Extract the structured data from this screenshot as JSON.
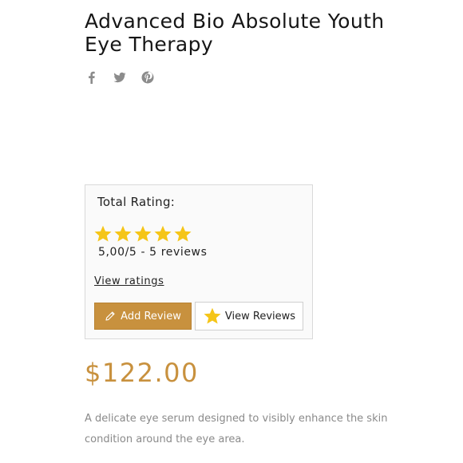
{
  "product": {
    "title": "Advanced Bio Absolute Youth Eye Therapy",
    "price": "$122.00",
    "description": "A delicate eye serum designed to visibly enhance the skin condition around the eye area."
  },
  "share": {
    "icons": [
      "facebook-icon",
      "twitter-icon",
      "pinterest-icon"
    ]
  },
  "rating": {
    "label": "Total Rating:",
    "stars": 5,
    "max_stars": 5,
    "summary": "5,00/5 - 5 reviews",
    "view_ratings_label": "View ratings",
    "add_review_label": "Add Review",
    "view_reviews_label": "View Reviews"
  },
  "colors": {
    "accent": "#c8913e",
    "star": "#f5c518",
    "icon_gray": "#8c8c8c",
    "text_muted": "#8a8a8a"
  }
}
